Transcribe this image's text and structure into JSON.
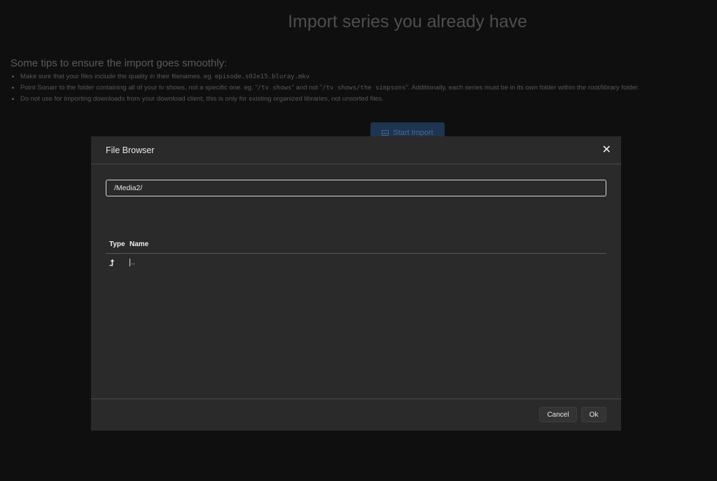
{
  "page": {
    "title": "Import series you already have",
    "tips_heading": "Some tips to ensure the import goes smoothly:",
    "tips": [
      {
        "before": "Make sure that your files include the quality in their filenames. eg. ",
        "code": "episode.s02e15.bluray.mkv",
        "between": "",
        "code2": "",
        "after": ""
      },
      {
        "before": "Point Sonarr to the folder containing all of your tv shows, not a specific one. eg. \"",
        "code": "/tv shows",
        "between": "\" and not \"",
        "code2": "/tv shows/the simpsons",
        "after": "\". Additionally, each series must be in its own folder within the root/library folder."
      },
      {
        "before": "Do not use for importing downloads from your download client, this is only for existing organized libraries, not unsorted files.",
        "code": "",
        "between": "",
        "code2": "",
        "after": ""
      }
    ],
    "start_import_label": "Start Import"
  },
  "modal": {
    "title": "File Browser",
    "close_icon": "close-icon",
    "path_value": "/Media2/",
    "columns": {
      "type": "Type",
      "name": "Name"
    },
    "rows": [
      {
        "type_icon": "parent-folder-icon",
        "type_glyph": "⮭",
        "name": ".."
      }
    ],
    "cancel_label": "Cancel",
    "ok_label": "Ok"
  },
  "colors": {
    "modal_bg": "#2a2a2a",
    "page_bg": "#0f0f0f",
    "primary_dimmed": "#1e3450"
  }
}
